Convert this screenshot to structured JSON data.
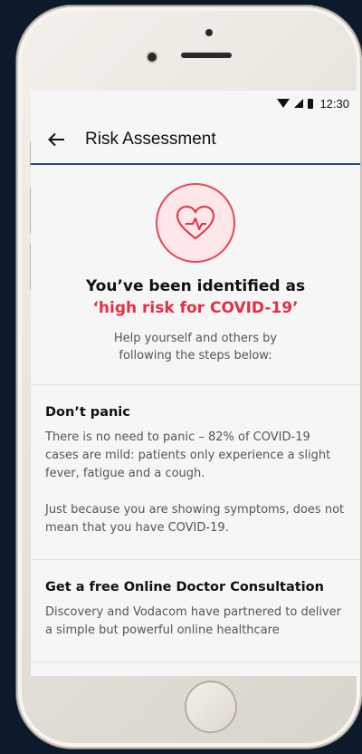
{
  "status_bar": {
    "time": "12:30"
  },
  "app_bar": {
    "title": "Risk Assessment"
  },
  "hero": {
    "line1": "You’ve been identified as",
    "line2": "‘high risk for COVID-19’",
    "subtitle": "Help yourself and others by\nfollowing the steps below:",
    "accent_color": "#e23046",
    "icon": "heart-pulse-icon"
  },
  "sections": [
    {
      "title": "Don’t panic",
      "paragraphs": [
        "There is no need to panic – 82% of COVID-19 cases are mild: patients only experience a slight fever, fatigue and a cough.",
        "Just because you are showing symptoms, does not mean that you have COVID-19."
      ]
    },
    {
      "title": "Get a free Online Doctor Consultation",
      "paragraphs": [
        "Discovery and Vodacom have partnered to deliver a simple but powerful online healthcare"
      ]
    }
  ],
  "colors": {
    "app_bar_border": "#1d4b8f",
    "background": "#0d1a2b"
  }
}
